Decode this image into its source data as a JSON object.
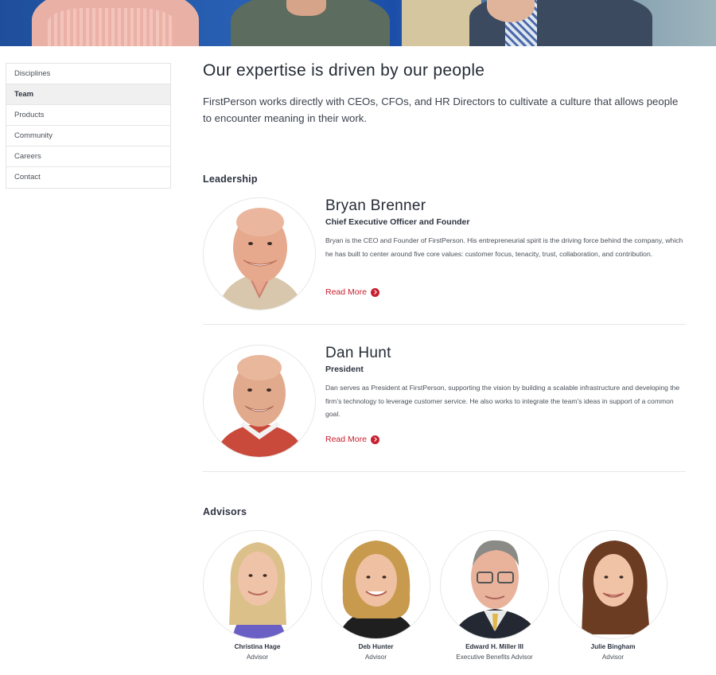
{
  "sidebar": {
    "items": [
      {
        "label": "Disciplines"
      },
      {
        "label": "Team"
      },
      {
        "label": "Products"
      },
      {
        "label": "Community"
      },
      {
        "label": "Careers"
      },
      {
        "label": "Contact"
      }
    ],
    "active": "Team"
  },
  "main": {
    "title": "Our expertise is driven by our people",
    "intro": "FirstPerson works directly with CEOs, CFOs, and HR Directors to cultivate a culture that allows people to encounter meaning in their work.",
    "leadership": {
      "heading": "Leadership",
      "members": [
        {
          "name": "Bryan Brenner",
          "role": "Chief Executive Officer and Founder",
          "bio": "Bryan is the CEO and Founder of FirstPerson. His entrepreneurial spirit is the driving force behind the company, which he has built to center around five core values: customer focus, tenacity, trust, collaboration, and contribution.",
          "read_more": "Read More"
        },
        {
          "name": "Dan Hunt",
          "role": "President",
          "bio": "Dan serves as President at FirstPerson, supporting the vision by building a scalable infrastructure and developing the firm’s technology to leverage customer service. He also works to integrate the team’s ideas in support of a common goal.",
          "read_more": "Read More"
        }
      ]
    },
    "advisors": {
      "heading": "Advisors",
      "members": [
        {
          "name": "Christina Hage",
          "role": "Advisor"
        },
        {
          "name": "Deb Hunter",
          "role": "Advisor"
        },
        {
          "name": "Edward H. Miller III",
          "role": "Executive Benefits Advisor"
        },
        {
          "name": "Julie Bingham",
          "role": "Advisor"
        }
      ]
    }
  },
  "colors": {
    "accent": "#c8202f",
    "text": "#2c3340",
    "hero_blue": "#1f4f9b"
  },
  "icons": {
    "read_more": "chevron-right-circle-icon"
  }
}
